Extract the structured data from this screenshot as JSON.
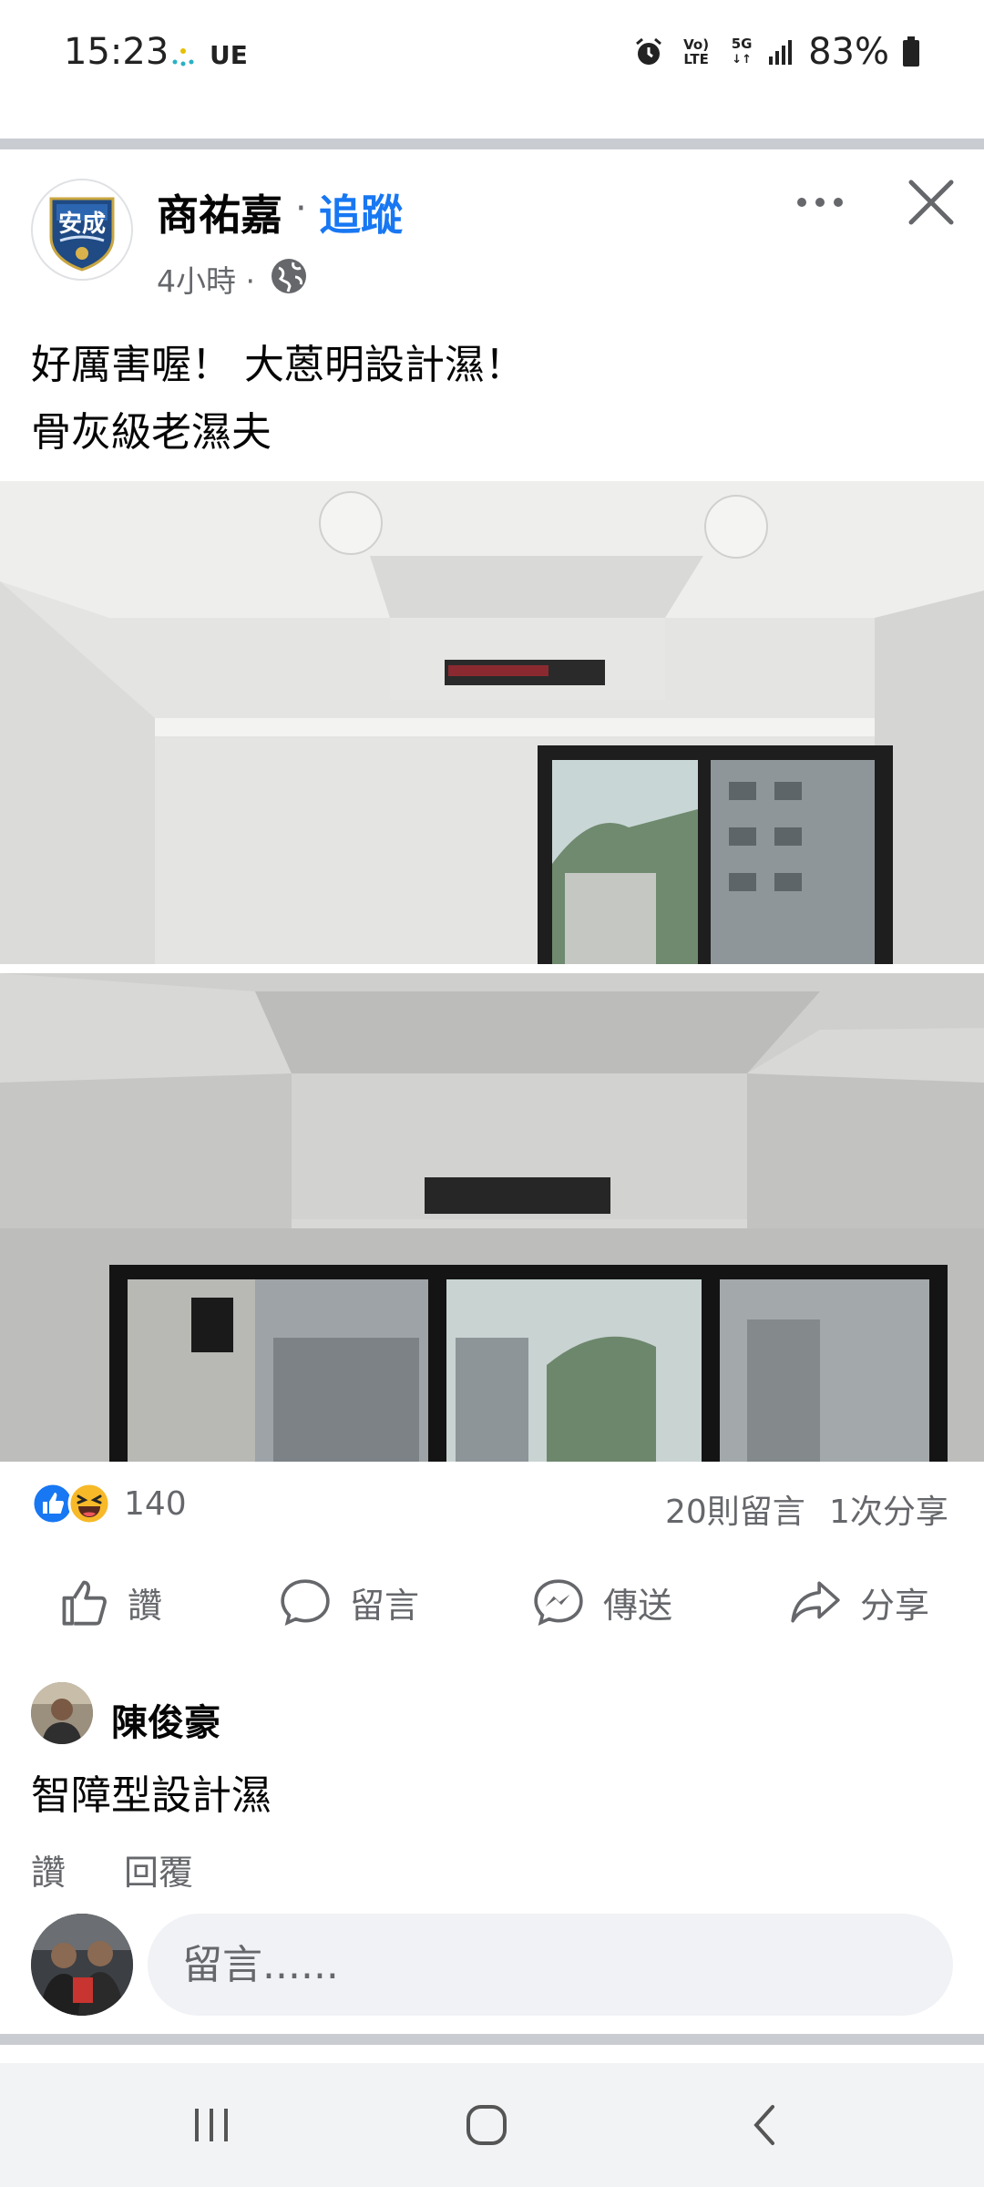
{
  "status_bar": {
    "time": "15:23",
    "carrier": "UE",
    "volte": "Vo) LTE",
    "network": "5G",
    "battery": "83%"
  },
  "previous_actions": {
    "like": "讚",
    "comment": "留言",
    "send": "傳送",
    "share": "分享"
  },
  "post": {
    "author": "商祐嘉",
    "separator": "·",
    "follow": "追蹤",
    "time": "4小時 ·",
    "text_line1": "好厲害喔！ 大蒽明設計濕！",
    "text_line2": "骨灰級老濕夫",
    "reaction_count": "140",
    "comment_count": "20則留言",
    "share_count": "1次分享"
  },
  "actions": {
    "like": "讚",
    "comment": "留言",
    "send": "傳送",
    "share": "分享"
  },
  "comment": {
    "author": "陳俊豪",
    "text": "智障型設計濕",
    "like": "讚",
    "reply": "回覆"
  },
  "composer": {
    "placeholder": "留言......"
  },
  "colors": {
    "accent": "#1877f2",
    "secondary_text": "#65676b",
    "divider": "#c9ccd1"
  }
}
